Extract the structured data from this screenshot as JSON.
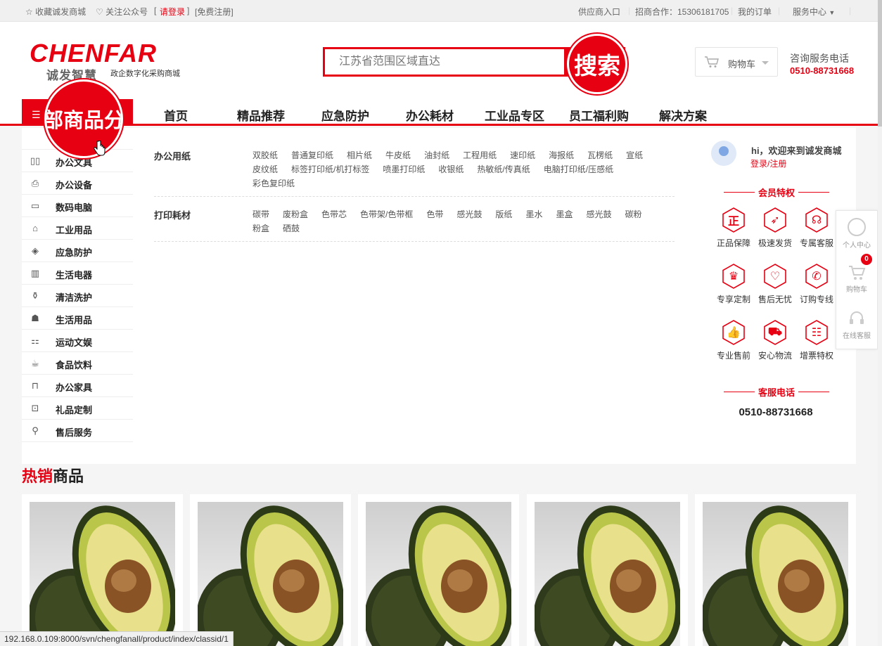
{
  "topbar": {
    "favorite": "收藏诚发商城",
    "follow": "关注公众号",
    "login_open": "[",
    "login": "请登录",
    "login_close": "]",
    "register": "[免费注册]",
    "supplier": "供应商入口",
    "invest": "招商合作：15306181705",
    "orders": "我的订单",
    "service": "服务中心"
  },
  "logo": {
    "brand": "CHENFAR",
    "cn": "诚发智慧",
    "subtitle": "政企数字化采购商城"
  },
  "search": {
    "placeholder": "江苏省范围区域直达",
    "button": "搜索"
  },
  "cart": {
    "label": "购物车"
  },
  "hotline": {
    "label": "咨询服务电话",
    "number": "0510-88731668"
  },
  "nav": {
    "all_categories": "全部商品分类",
    "all_categories_visible": "部商品分",
    "items": [
      "首页",
      "精品推荐",
      "应急防护",
      "办公耗材",
      "工业品专区",
      "员工福利购",
      "解决方案"
    ]
  },
  "sidebar": {
    "items": [
      {
        "label": "办公文具",
        "icon": "binder-icon"
      },
      {
        "label": "办公设备",
        "icon": "printer-icon"
      },
      {
        "label": "数码电脑",
        "icon": "monitor-icon"
      },
      {
        "label": "工业用品",
        "icon": "helmet-icon"
      },
      {
        "label": "应急防护",
        "icon": "protection-icon"
      },
      {
        "label": "生活电器",
        "icon": "fridge-icon"
      },
      {
        "label": "清洁洗护",
        "icon": "bottle-icon"
      },
      {
        "label": "生活用品",
        "icon": "basket-icon"
      },
      {
        "label": "运动文娱",
        "icon": "sports-icon"
      },
      {
        "label": "食品饮料",
        "icon": "drink-icon"
      },
      {
        "label": "办公家具",
        "icon": "furniture-icon"
      },
      {
        "label": "礼品定制",
        "icon": "gift-icon"
      },
      {
        "label": "售后服务",
        "icon": "service-icon"
      }
    ]
  },
  "dropdown": {
    "groups": [
      {
        "title": "办公用纸",
        "links": [
          "双胶纸",
          "普通复印纸",
          "相片纸",
          "牛皮纸",
          "油封纸",
          "工程用纸",
          "速印纸",
          "海报纸",
          "瓦楞纸",
          "宣纸",
          "皮纹纸",
          "标签打印纸/机打标签",
          "喷墨打印纸",
          "收银纸",
          "热敏纸/传真纸",
          "电脑打印纸/压感纸",
          "彩色复印纸"
        ]
      },
      {
        "title": "打印耗材",
        "links": [
          "碳带",
          "废粉盒",
          "色带芯",
          "色带架/色带框",
          "色带",
          "感光鼓",
          "版纸",
          "墨水",
          "墨盒",
          "感光鼓",
          "碳粉",
          "粉盒",
          "硒鼓"
        ]
      }
    ]
  },
  "member": {
    "welcome": "hi，欢迎来到诚发商城",
    "login_register": "登录/注册",
    "perks_title": "会员特权",
    "perks": [
      {
        "label": "正品保障",
        "icon": "genuine-icon",
        "glyph": "正"
      },
      {
        "label": "极速发货",
        "icon": "rocket-icon",
        "glyph": "➶"
      },
      {
        "label": "专属客服",
        "icon": "headset-icon",
        "glyph": "☊"
      },
      {
        "label": "专享定制",
        "icon": "crown-icon",
        "glyph": "♛"
      },
      {
        "label": "售后无忧",
        "icon": "heart-icon",
        "glyph": "♡"
      },
      {
        "label": "订购专线",
        "icon": "phone-icon",
        "glyph": "✆"
      },
      {
        "label": "专业售前",
        "icon": "thumbs-up-icon",
        "glyph": "👍"
      },
      {
        "label": "安心物流",
        "icon": "truck-icon",
        "glyph": "⛟"
      },
      {
        "label": "增票特权",
        "icon": "invoice-icon",
        "glyph": "☷"
      }
    ],
    "service_title": "客服电话",
    "service_number": "0510-88731668"
  },
  "floatbar": {
    "profile": "个人中心",
    "cart": "购物车",
    "cart_count": "0",
    "online": "在线客服"
  },
  "hot": {
    "title_red": "热销",
    "title_rest": "商品"
  },
  "products": [
    {
      "image": "avocado-image"
    },
    {
      "image": "avocado-image"
    },
    {
      "image": "avocado-image"
    },
    {
      "image": "avocado-image"
    },
    {
      "image": "avocado-image"
    }
  ],
  "statusbar": {
    "url": "192.168.0.109:8000/svn/chengfanall/product/index/classid/1"
  },
  "colors": {
    "brand": "#e60012",
    "text": "#333333",
    "background": "#f5f5f5"
  }
}
